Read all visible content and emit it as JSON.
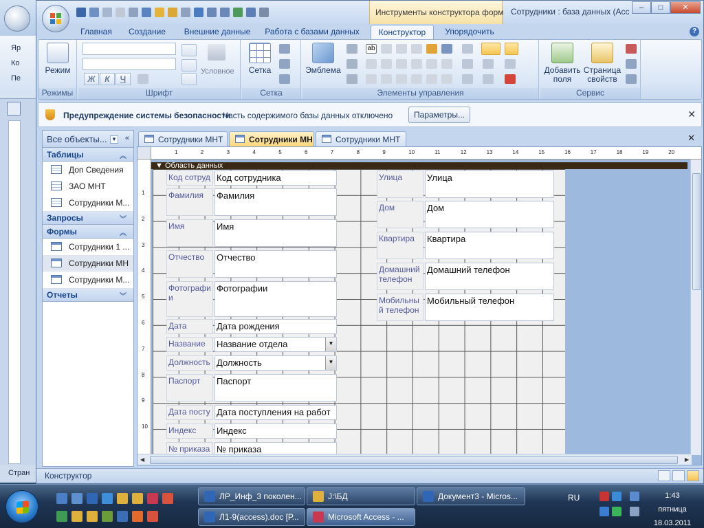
{
  "background_window": {
    "items": [
      "Яр",
      "Ко",
      "Пе"
    ],
    "status": "Стран"
  },
  "titlebar": {
    "context_tab": "Инструменты конструктора форм",
    "title": "Сотрудники : база данных (Acc",
    "btn_minimize": "–",
    "btn_maximize": "□",
    "btn_close": "✕"
  },
  "ribbon_tabs": [
    {
      "label": "Главная"
    },
    {
      "label": "Создание"
    },
    {
      "label": "Внешние данные"
    },
    {
      "label": "Работа с базами данных"
    },
    {
      "label": "Конструктор",
      "active": true
    },
    {
      "label": "Упорядочить"
    }
  ],
  "ribbon": {
    "group_modes": "Режимы",
    "mode_button": "Режим",
    "group_font": "Шрифт",
    "font_bold": "Ж",
    "font_italic": "К",
    "font_underline": "Ч",
    "conditional": "Условное",
    "group_grid": "Сетка",
    "grid_button": "Сетка",
    "group_controls": "Элементы управления",
    "logo_button": "Эмблема",
    "group_service": "Сервис",
    "add_fields_l1": "Добавить",
    "add_fields_l2": "поля",
    "property_sheet_l1": "Страница",
    "property_sheet_l2": "свойств"
  },
  "security_bar": {
    "title": "Предупреждение системы безопасности",
    "message": "Часть содержимого базы данных отключено",
    "button": "Параметры...",
    "close": "✕"
  },
  "nav": {
    "header": "Все объекты...",
    "sections": {
      "tables": "Таблицы",
      "queries": "Запросы",
      "forms": "Формы",
      "reports": "Отчеты"
    },
    "tables": [
      "Доп Сведения",
      "ЗАО МНТ",
      "Сотрудники М..."
    ],
    "forms": [
      "Сотрудники 1 ...",
      "Сотрудники МН",
      "Сотрудники М..."
    ]
  },
  "doc_tabs": [
    "Сотрудники МНТ",
    "Сотрудники МН",
    "Сотрудники МНТ"
  ],
  "doc_close": "✕",
  "ruler_h": [
    "1",
    "2",
    "3",
    "4",
    "5",
    "6",
    "7",
    "8",
    "9",
    "10",
    "11",
    "12",
    "13",
    "14",
    "15",
    "16",
    "17",
    "18",
    "19",
    "20"
  ],
  "ruler_v": [
    "1",
    "2",
    "3",
    "4",
    "5",
    "6",
    "7",
    "8",
    "9",
    "10"
  ],
  "section_header": "Область данных",
  "form": {
    "left": [
      {
        "label": "Код сотруд",
        "field": "Код сотрудника"
      },
      {
        "label": "Фамилия",
        "field": "Фамилия"
      },
      {
        "label": "Имя",
        "field": "Имя"
      },
      {
        "label": "Отчество",
        "field": "Отчество"
      },
      {
        "label": "Фотографи и",
        "field": "Фотографии"
      },
      {
        "label": "Дата рожде",
        "field": "Дата рождения"
      },
      {
        "label": "Название от",
        "field": "Название отдела"
      },
      {
        "label": "Должность",
        "field": "Должность"
      },
      {
        "label": "Паспорт",
        "field": "Паспорт"
      },
      {
        "label": "Дата посту",
        "field": "Дата поступления на работ"
      },
      {
        "label": "Индекс",
        "field": "Индекс"
      },
      {
        "label": "№ приказа",
        "field": "№ приказа"
      }
    ],
    "right": [
      {
        "label": "Улица",
        "field": "Улица"
      },
      {
        "label": "Дом",
        "field": "Дом"
      },
      {
        "label": "Квартира",
        "field": "Квартира"
      },
      {
        "label": "Домашний телефон",
        "field": "Домашний телефон"
      },
      {
        "label": "Мобильны й телефон",
        "field": "Мобильный телефон"
      }
    ]
  },
  "statusbar": {
    "text": "Конструктор"
  },
  "taskbar": {
    "buttons": [
      "ЛР_Инф_3 поколен...",
      "J:\\БД",
      "Документ3 - Micros...",
      "Л1-9(access).doc [Р...",
      "Microsoft Access - ..."
    ],
    "lang": "RU",
    "time": "1:43",
    "day": "пятница",
    "date": "18.03.2011"
  },
  "colors": {
    "accent": "#15428b",
    "ribbon_bg": "#dbe7f6",
    "context_tab": "#f6e2a8",
    "section_bar": "#3a2914",
    "taskbar": "#1f3554"
  }
}
